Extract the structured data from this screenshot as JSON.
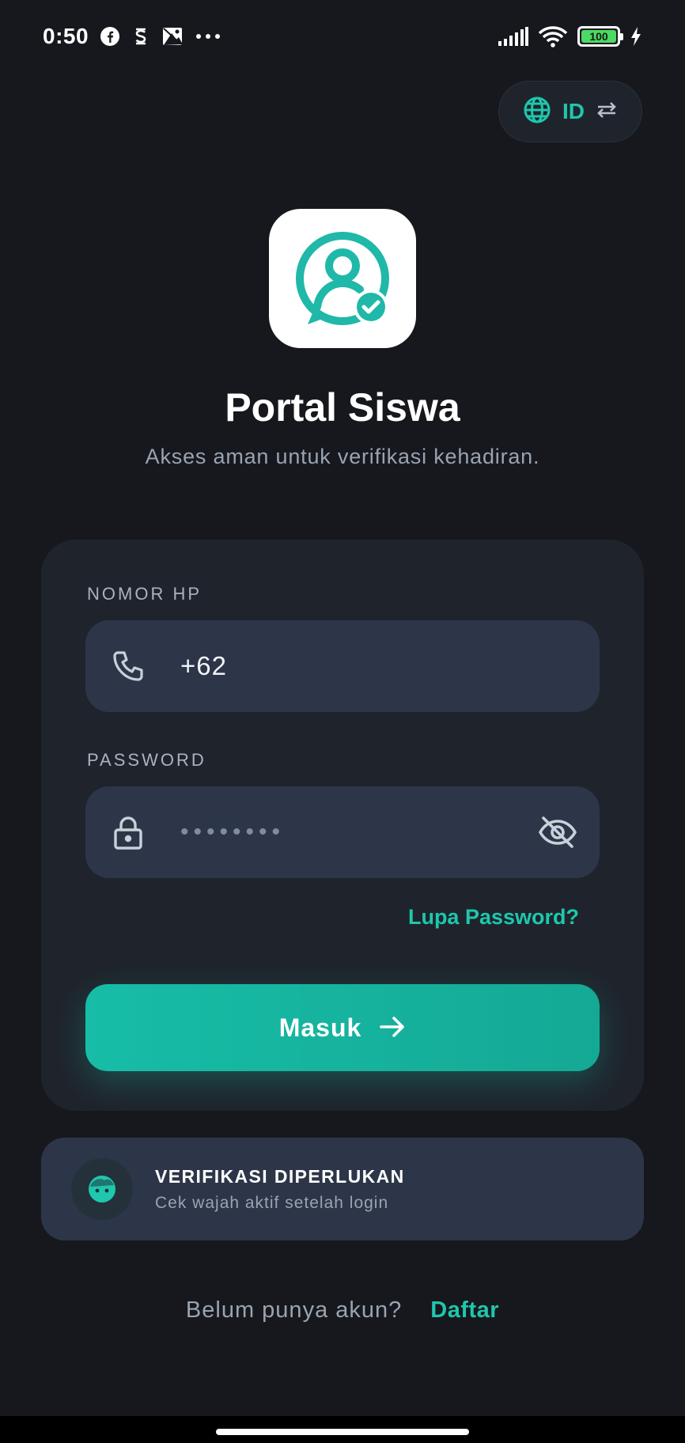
{
  "status_bar": {
    "time": "0:50",
    "battery": "100",
    "icons": [
      "facebook-icon",
      "s-app-icon",
      "photo-app-icon",
      "more-dots-icon",
      "signal-icon",
      "wifi-icon",
      "battery-icon",
      "charging-icon"
    ]
  },
  "language": {
    "code": "ID",
    "icon": "globe-icon",
    "swap_icon": "swap-arrows-icon"
  },
  "app": {
    "title": "Portal Siswa",
    "subtitle": "Akses aman untuk verifikasi kehadiran."
  },
  "form": {
    "phone_label": "NOMOR HP",
    "phone_value": "+62",
    "password_label": "PASSWORD",
    "password_mask": "••••••••",
    "forgot_label": "Lupa Password?",
    "login_label": "Masuk"
  },
  "verification": {
    "title": "VERIFIKASI DIPERLUKAN",
    "subtitle": "Cek wajah aktif setelah login"
  },
  "footer": {
    "question": "Belum punya akun?",
    "signup_label": "Daftar"
  },
  "colors": {
    "background": "#16181d",
    "card": "#1f242c",
    "field": "#2d3648",
    "accent": "#1ec7ad",
    "button": "#17bda7"
  }
}
